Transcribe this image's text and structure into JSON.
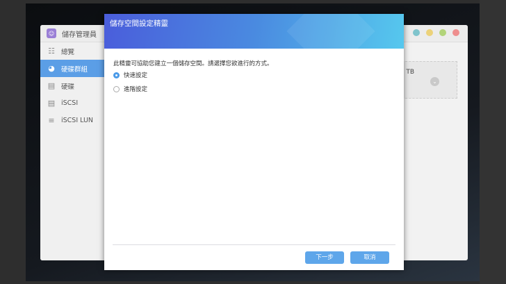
{
  "app": {
    "title": "儲存管理員",
    "window_dots": [
      "#7fc4cc",
      "#ecd27a",
      "#b2d47a",
      "#ee8e8e"
    ]
  },
  "sidebar": {
    "items": [
      {
        "label": "總覽",
        "icon": "list-icon"
      },
      {
        "label": "硬碟群組",
        "icon": "disk-group-icon",
        "active": true
      },
      {
        "label": "硬碟",
        "icon": "hdd-icon"
      },
      {
        "label": "iSCSI",
        "icon": "iscsi-icon"
      },
      {
        "label": "iSCSI LUN",
        "icon": "database-icon"
      }
    ]
  },
  "card": {
    "text": "' TB"
  },
  "dialog": {
    "title": "儲存空間設定精靈",
    "description": "此精靈可協助您建立一個儲存空間。請選擇您欲進行的方式。",
    "options": [
      {
        "label": "快速設定",
        "selected": true
      },
      {
        "label": "進階設定",
        "selected": false
      }
    ],
    "next_label": "下一步",
    "cancel_label": "取消"
  }
}
